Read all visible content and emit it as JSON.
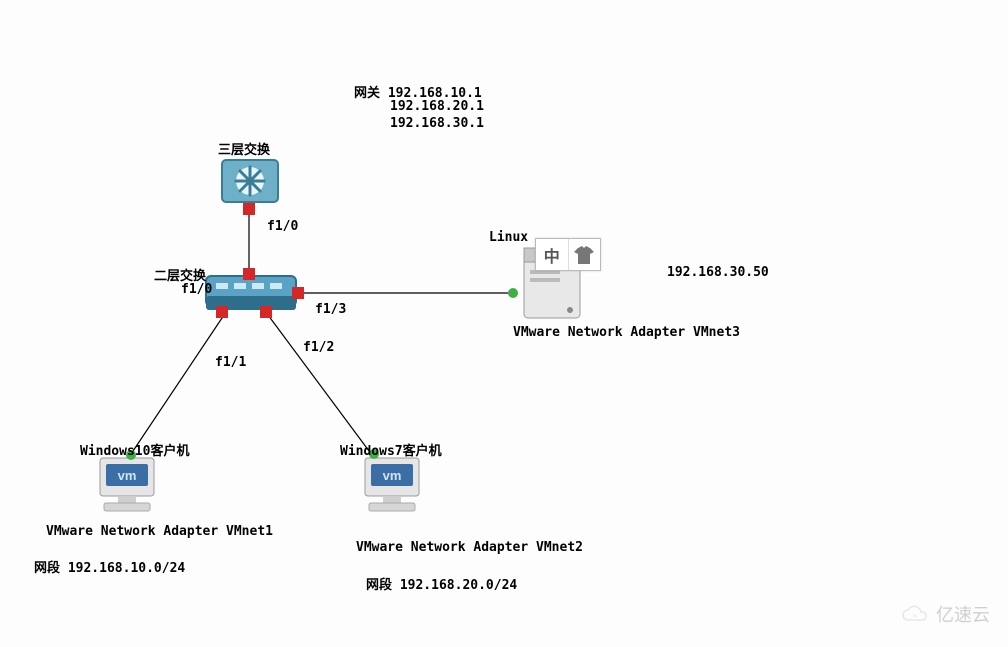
{
  "gateway": {
    "label": "网关",
    "ips": [
      "192.168.10.1",
      "192.168.20.1",
      "192.168.30.1"
    ]
  },
  "devices": {
    "l3switch": {
      "label": "三层交换",
      "ports": [
        "f1/0"
      ]
    },
    "l2switch": {
      "label": "二层交换",
      "ports": [
        "f1/0",
        "f1/1",
        "f1/2",
        "f1/3"
      ]
    },
    "win10": {
      "label": "Windows10客户机",
      "adapter": "VMware Network Adapter VMnet1",
      "network_label": "网段 192.168.10.0/24"
    },
    "win7": {
      "label": "Windows7客户机",
      "adapter": "VMware Network Adapter VMnet2",
      "network_label": "网段 192.168.20.0/24"
    },
    "linux": {
      "label": "Linux",
      "adapter": "VMware Network Adapter VMnet3",
      "ip": "192.168.30.50"
    }
  },
  "ime": {
    "char": "中"
  },
  "watermark": "亿速云",
  "chart_data": {
    "type": "network-diagram",
    "nodes": [
      {
        "id": "l3switch",
        "type": "layer3-switch",
        "label": "三层交换",
        "gateways": [
          "192.168.10.1",
          "192.168.20.1",
          "192.168.30.1"
        ]
      },
      {
        "id": "l2switch",
        "type": "layer2-switch",
        "label": "二层交换"
      },
      {
        "id": "win10",
        "type": "vm-client",
        "label": "Windows10客户机",
        "adapter": "VMware Network Adapter VMnet1",
        "network": "192.168.10.0/24"
      },
      {
        "id": "win7",
        "type": "vm-client",
        "label": "Windows7客户机",
        "adapter": "VMware Network Adapter VMnet2",
        "network": "192.168.20.0/24"
      },
      {
        "id": "linux",
        "type": "server",
        "label": "Linux",
        "adapter": "VMware Network Adapter VMnet3",
        "ip": "192.168.30.50"
      }
    ],
    "links": [
      {
        "from": "l3switch",
        "from_port": "f1/0",
        "to": "l2switch",
        "to_port": "f1/0",
        "status": "red-red"
      },
      {
        "from": "l2switch",
        "from_port": "f1/1",
        "to": "win10",
        "status": "red-green"
      },
      {
        "from": "l2switch",
        "from_port": "f1/2",
        "to": "win7",
        "status": "red-green"
      },
      {
        "from": "l2switch",
        "from_port": "f1/3",
        "to": "linux",
        "status": "red-green"
      }
    ]
  }
}
